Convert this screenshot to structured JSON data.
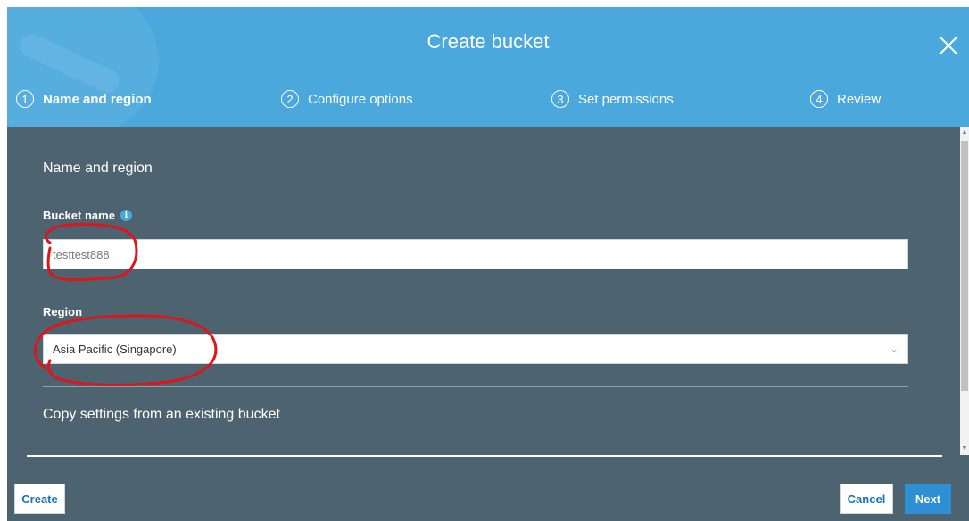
{
  "dialog": {
    "title": "Create bucket",
    "close_icon": "close-icon"
  },
  "steps": [
    {
      "number": "1",
      "label": "Name and region",
      "active": true
    },
    {
      "number": "2",
      "label": "Configure options",
      "active": false
    },
    {
      "number": "3",
      "label": "Set permissions",
      "active": false
    },
    {
      "number": "4",
      "label": "Review",
      "active": false
    }
  ],
  "form": {
    "section_title": "Name and region",
    "bucket_name_label": "Bucket name",
    "bucket_name_info_icon": "info-icon",
    "bucket_name_value": "testtest888",
    "region_label": "Region",
    "region_value": "Asia Pacific (Singapore)",
    "region_chevron_icon": "chevron-down-icon",
    "copy_settings_title": "Copy settings from an existing bucket"
  },
  "footer": {
    "create_label": "Create",
    "cancel_label": "Cancel",
    "next_label": "Next"
  },
  "colors": {
    "header_bg": "#4aa8dd",
    "body_bg": "#4e6370",
    "primary_button": "#2e8fd4",
    "annotation": "#e0141b"
  }
}
